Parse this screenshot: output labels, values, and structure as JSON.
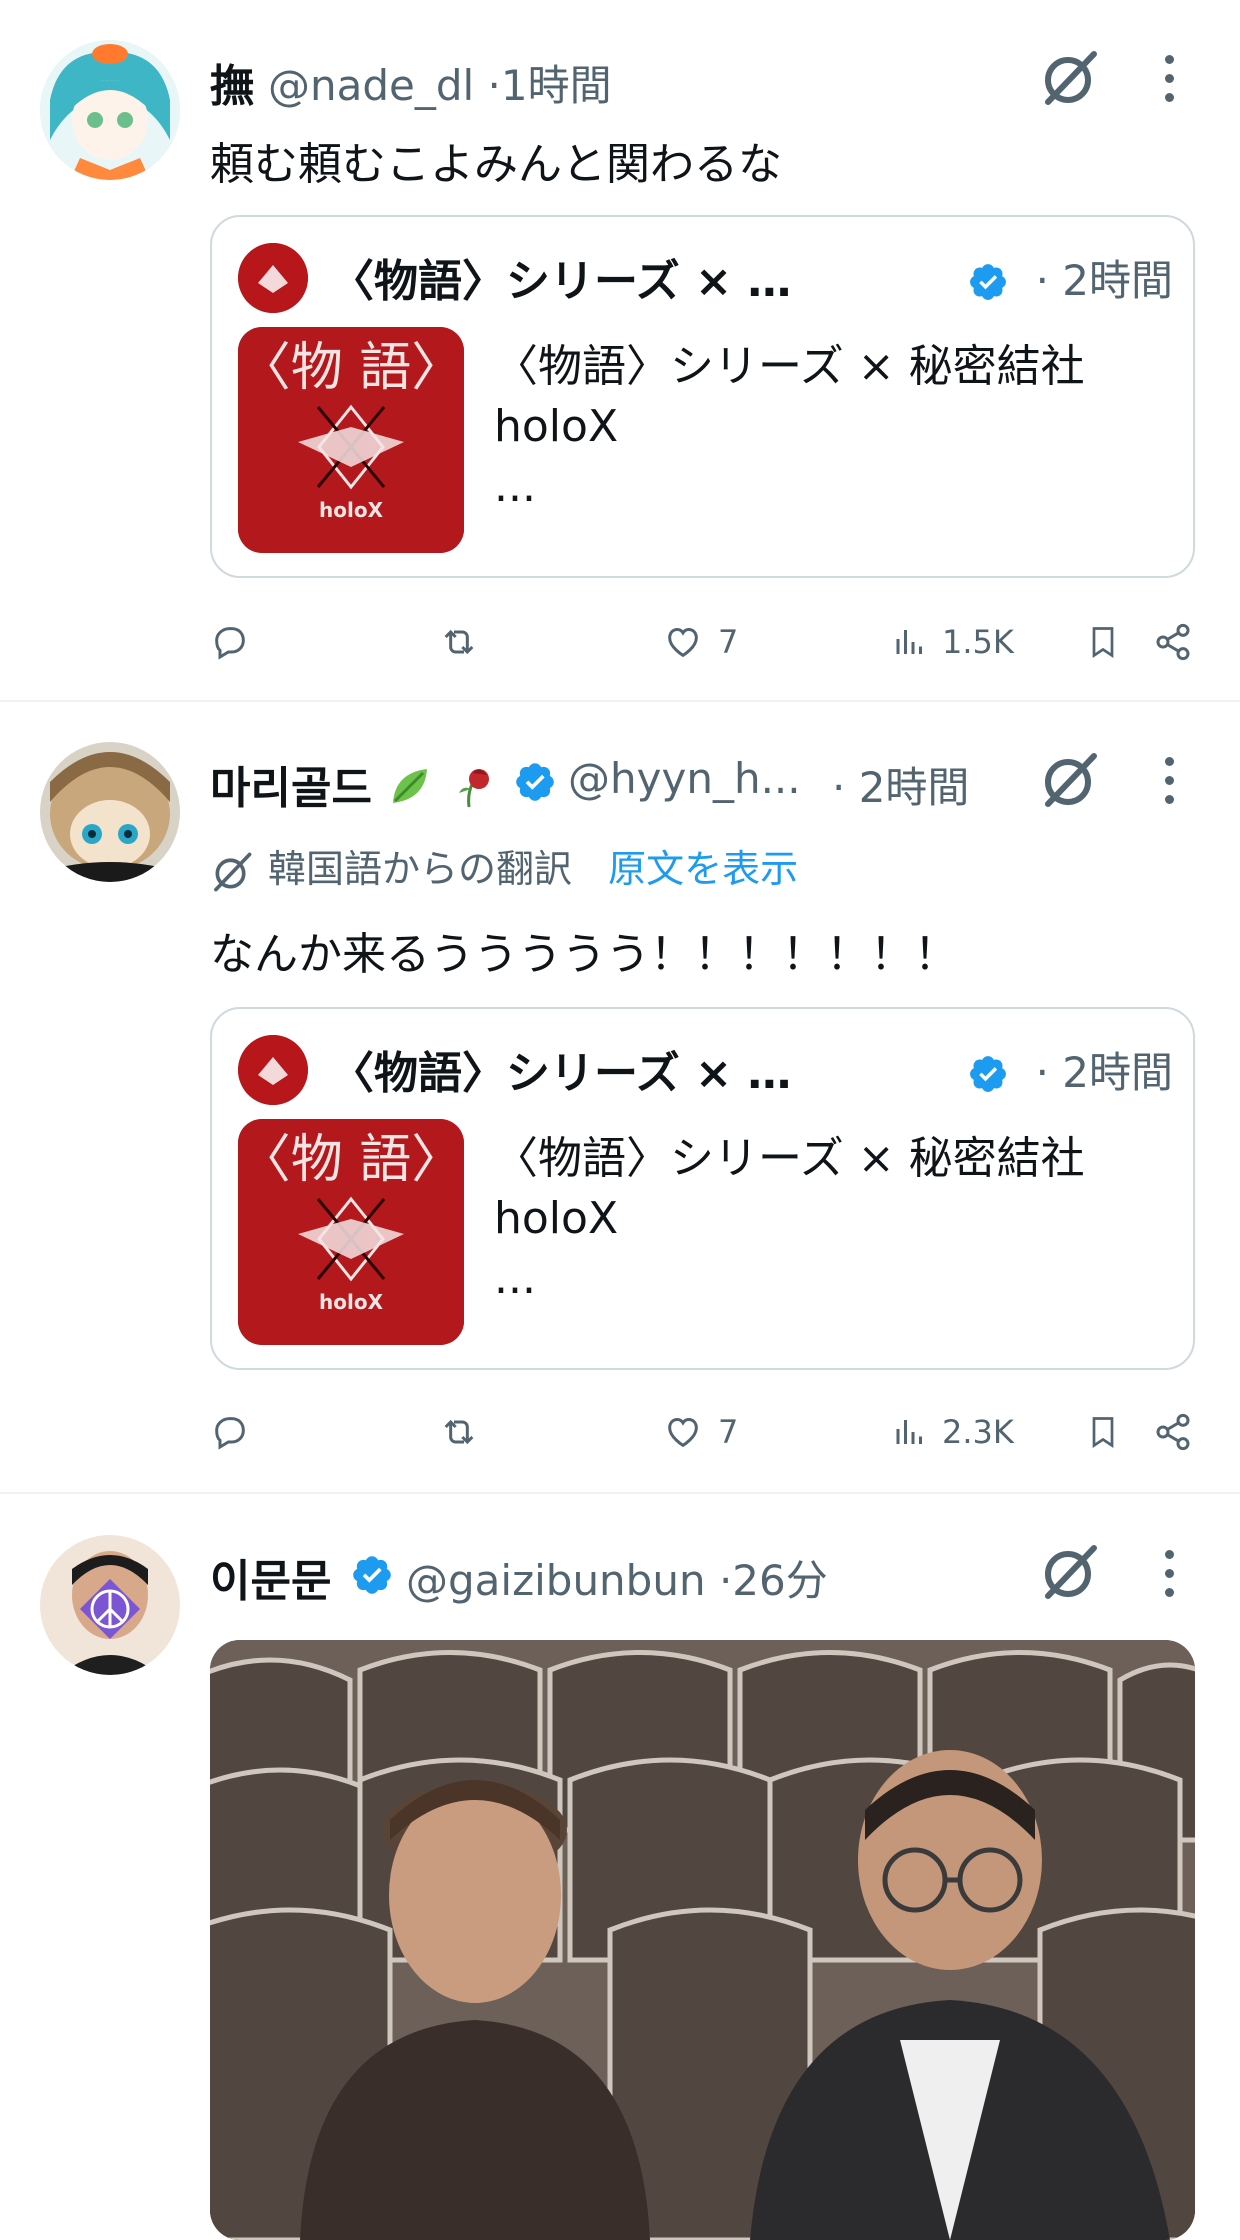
{
  "tweets": [
    {
      "name": "撫",
      "handle": "@nade_dl",
      "separator": "·",
      "time": "1時間",
      "text": "頼む頼むこよみんと関わるな",
      "quote": {
        "name": "〈物語〉シリーズ × 秘密結...",
        "time": "· 2時間",
        "body_line1": "〈物語〉シリーズ × 秘密結社",
        "body_line2": "holoX",
        "body_line3": "...",
        "thumb_logo": "holoX"
      },
      "actions": {
        "likes": "7",
        "views": "1.5K"
      }
    },
    {
      "name": "마리골드",
      "handle": "@hyyn_h...",
      "time": "· 2時間",
      "translation_note": "韓国語からの翻訳",
      "show_original": "原文を表示",
      "text": "なんか来るううううう！！！！！！！",
      "quote": {
        "name": "〈物語〉シリーズ × 秘密結...",
        "time": "· 2時間",
        "body_line1": "〈物語〉シリーズ × 秘密結社",
        "body_line2": "holoX",
        "body_line3": "...",
        "thumb_logo": "holoX"
      },
      "actions": {
        "likes": "7",
        "views": "2.3K"
      }
    },
    {
      "name": "이문문",
      "handle": "@gaizibunbun",
      "separator": "·",
      "time": "26分"
    }
  ],
  "colors": {
    "accent": "#1d9bf0",
    "muted": "#536471",
    "quote_red": "#b3181c"
  },
  "icons": [
    "grok-icon",
    "more-icon",
    "verified-icon",
    "reply-icon",
    "repost-icon",
    "like-icon",
    "views-icon",
    "bookmark-icon",
    "share-icon",
    "translate-icon",
    "leaf-emoji",
    "wilted-rose-emoji"
  ]
}
